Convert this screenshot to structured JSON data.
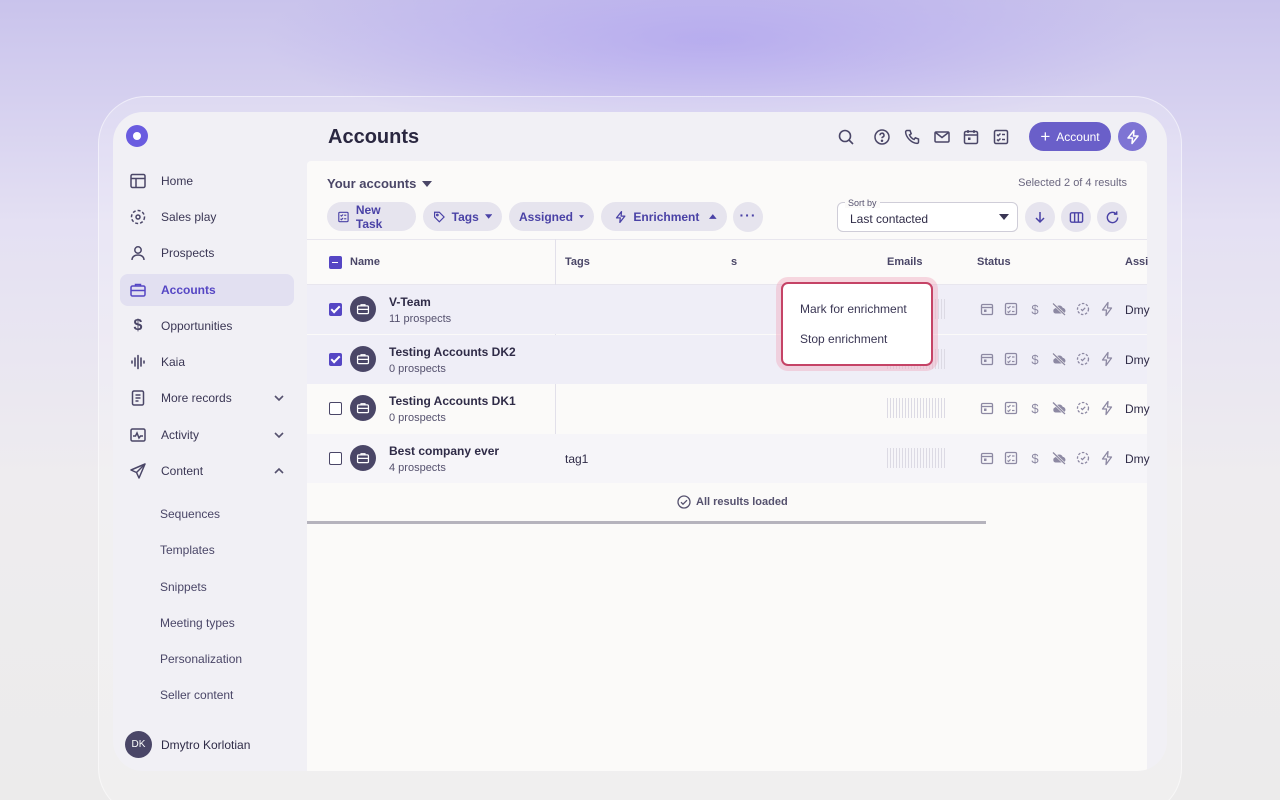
{
  "colors": {
    "accent": "#6a5ce0",
    "highlight": "#c54366",
    "text": "#2f2b47"
  },
  "sidebar": {
    "logo_icon": "shield-logo",
    "items": [
      {
        "label": "Home",
        "icon": "layout-icon"
      },
      {
        "label": "Sales play",
        "icon": "target-icon"
      },
      {
        "label": "Prospects",
        "icon": "person-icon"
      },
      {
        "label": "Accounts",
        "icon": "briefcase-icon",
        "active": true
      },
      {
        "label": "Opportunities",
        "icon": "dollar-icon"
      },
      {
        "label": "Kaia",
        "icon": "waveform-icon"
      },
      {
        "label": "More records",
        "icon": "document-icon",
        "chevron": "down"
      },
      {
        "label": "Activity",
        "icon": "activity-icon",
        "chevron": "down"
      },
      {
        "label": "Content",
        "icon": "send-icon",
        "chevron": "up"
      }
    ],
    "sub_items": [
      "Sequences",
      "Templates",
      "Snippets",
      "Meeting types",
      "Personalization",
      "Seller content"
    ],
    "user": {
      "initials": "DK",
      "name": "Dmytro Korlotian"
    }
  },
  "header": {
    "title": "Accounts",
    "icons": [
      "search-icon",
      "help-icon",
      "phone-icon",
      "mail-icon",
      "calendar-icon",
      "task-icon"
    ],
    "add_button": "Account",
    "bolt_icon": "bolt-icon"
  },
  "toolbar": {
    "view_label": "Your accounts",
    "selection": "Selected 2 of 4 results",
    "new_task": "New Task",
    "tags": "Tags",
    "assigned": "Assigned",
    "enrichment": "Enrichment",
    "more_icon": "more-icon",
    "sort": {
      "label": "Sort by",
      "value": "Last contacted"
    }
  },
  "table": {
    "columns": {
      "name": "Name",
      "tags": "Tags",
      "tags_tail": "s",
      "emails": "Emails",
      "status": "Status",
      "assigned": "Assi"
    },
    "rows": [
      {
        "name": "V-Team",
        "sub": "11 prospects",
        "tags": "",
        "checked": true,
        "assignee": "Dmy"
      },
      {
        "name": "Testing Accounts DK2",
        "sub": "0 prospects",
        "tags": "",
        "checked": true,
        "assignee": "Dmy"
      },
      {
        "name": "Testing Accounts DK1",
        "sub": "0 prospects",
        "tags": "",
        "checked": false,
        "assignee": "Dmy"
      },
      {
        "name": "Best company ever",
        "sub": "4 prospects",
        "tags": "tag1",
        "checked": false,
        "assignee": "Dmy"
      }
    ],
    "footer": "All results loaded"
  },
  "dropdown": {
    "items": [
      "Mark for enrichment",
      "Stop enrichment"
    ]
  }
}
